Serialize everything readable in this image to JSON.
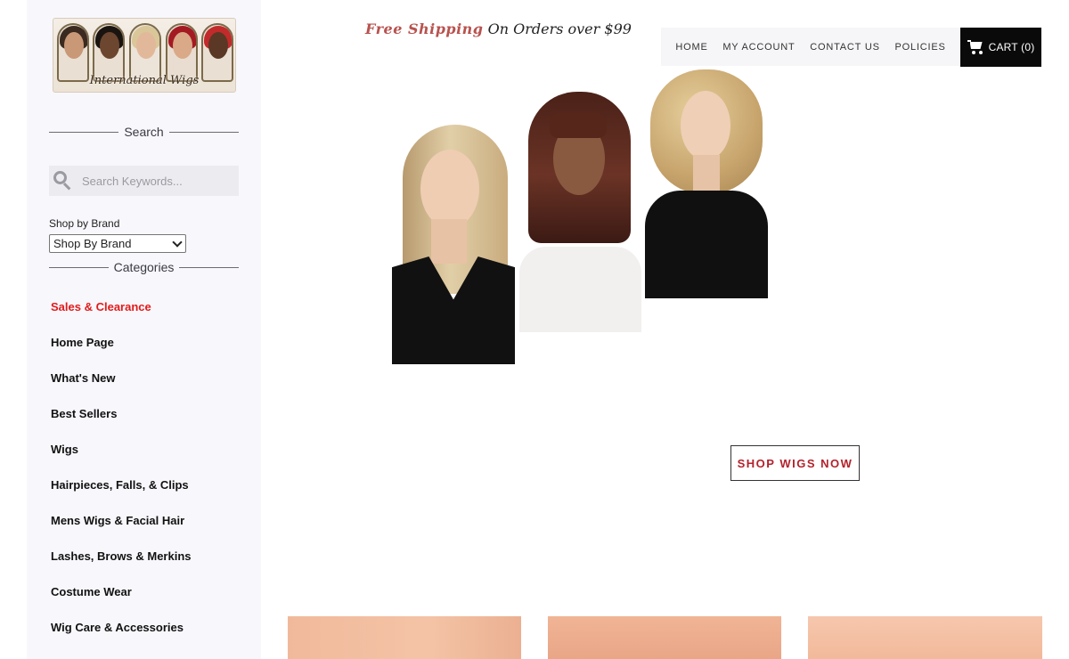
{
  "logo": {
    "script_text": "International Wigs"
  },
  "sidebar": {
    "search_title": "Search",
    "search_placeholder": "Search Keywords...",
    "brand_label": "Shop by Brand",
    "brand_selected": "Shop By Brand",
    "categories_title": "Categories",
    "categories": [
      "Sales & Clearance",
      "Home Page",
      "What's New",
      "Best Sellers",
      "Wigs",
      "Hairpieces, Falls, & Clips",
      "Mens Wigs & Facial Hair",
      "Lashes, Brows & Merkins",
      "Costume Wear",
      "Wig Care & Accessories"
    ]
  },
  "promo": {
    "highlight": "Free Shipping",
    "rest": "On Orders over $99"
  },
  "topnav": {
    "home": "HOME",
    "account": "MY ACCOUNT",
    "contact": "CONTACT US",
    "policies": "POLICIES"
  },
  "cart": {
    "label": "CART (0)"
  },
  "hero": {
    "button": "SHOP WIGS NOW"
  },
  "colors": {
    "sale_red": "#e21b1b",
    "button_text": "#b3222c",
    "promo_highlight": "#b8524e",
    "cart_bg": "#0a0a0a",
    "sidebar_bg": "#f8f7fc"
  }
}
